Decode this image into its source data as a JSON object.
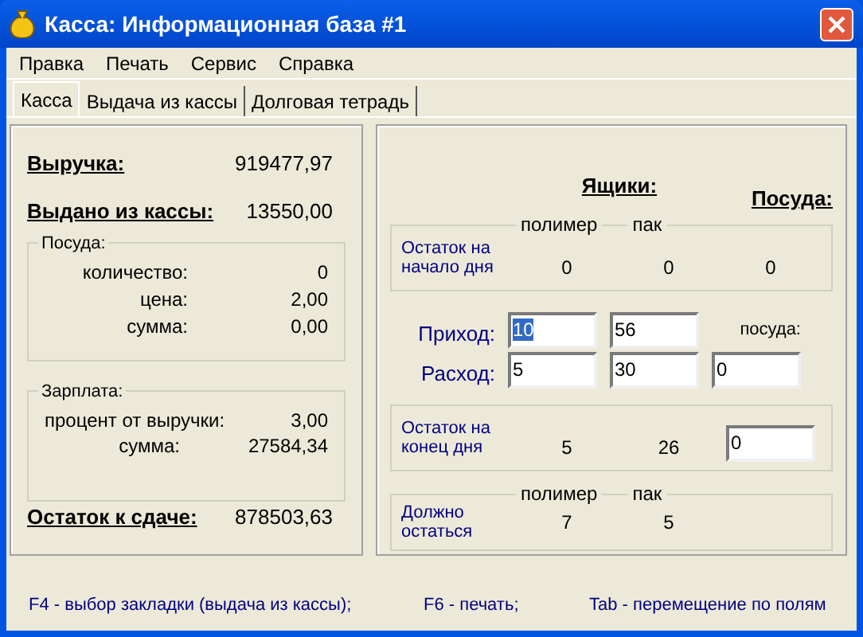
{
  "window": {
    "title": "Касса: Информационная база #1"
  },
  "menu": [
    "Правка",
    "Печать",
    "Сервис",
    "Справка"
  ],
  "tabs": [
    {
      "label": "Касса",
      "selected": true
    },
    {
      "label": "Выдача из кассы",
      "selected": false
    },
    {
      "label": "Долговая тетрадь",
      "selected": false
    }
  ],
  "revenue": {
    "label": "Выручка:",
    "value": "919477,97"
  },
  "issued": {
    "label": "Выдано из кассы:",
    "value": "13550,00"
  },
  "dishes_group": {
    "title": "Посуда:",
    "rows": [
      {
        "label": "количество:",
        "value": "0"
      },
      {
        "label": "цена:",
        "value": "2,00"
      },
      {
        "label": "сумма:",
        "value": "0,00"
      }
    ]
  },
  "salary_group": {
    "title": "Зарплата:",
    "rows": [
      {
        "label": "процент от выручки:",
        "value": "3,00"
      },
      {
        "label": "сумма:",
        "value": "27584,34"
      }
    ]
  },
  "remainder": {
    "label": "Остаток к сдаче:",
    "value": "878503,63"
  },
  "right": {
    "boxes_heading": "Ящики:",
    "dishes_heading": "Посуда:",
    "start": {
      "label_lines": [
        "Остаток на",
        "начало дня"
      ],
      "col_labels": [
        "полимер",
        "пак"
      ],
      "values": [
        "0",
        "0",
        "0"
      ]
    },
    "income": {
      "label": "Приход:",
      "fields": [
        {
          "value": "10",
          "selected": true
        },
        {
          "value": "56",
          "selected": false
        }
      ]
    },
    "dishes_label": "посуда:",
    "expense": {
      "label": "Расход:",
      "fields": [
        {
          "value": "5",
          "selected": false
        },
        {
          "value": "30",
          "selected": false
        },
        {
          "value": "0",
          "selected": false
        }
      ]
    },
    "end": {
      "label_lines": [
        "Остаток на",
        "конец дня"
      ],
      "values": [
        "5",
        "26"
      ],
      "field": {
        "value": "0",
        "selected": false
      }
    },
    "should": {
      "label_lines": [
        "Должно",
        "остаться"
      ],
      "col_labels": [
        "полимер",
        "пак"
      ],
      "values": [
        "7",
        "5"
      ]
    }
  },
  "footer": [
    "F4 - выбор закладки (выдача из кассы);",
    "F6 - печать;",
    "Tab - перемещение по полям"
  ]
}
